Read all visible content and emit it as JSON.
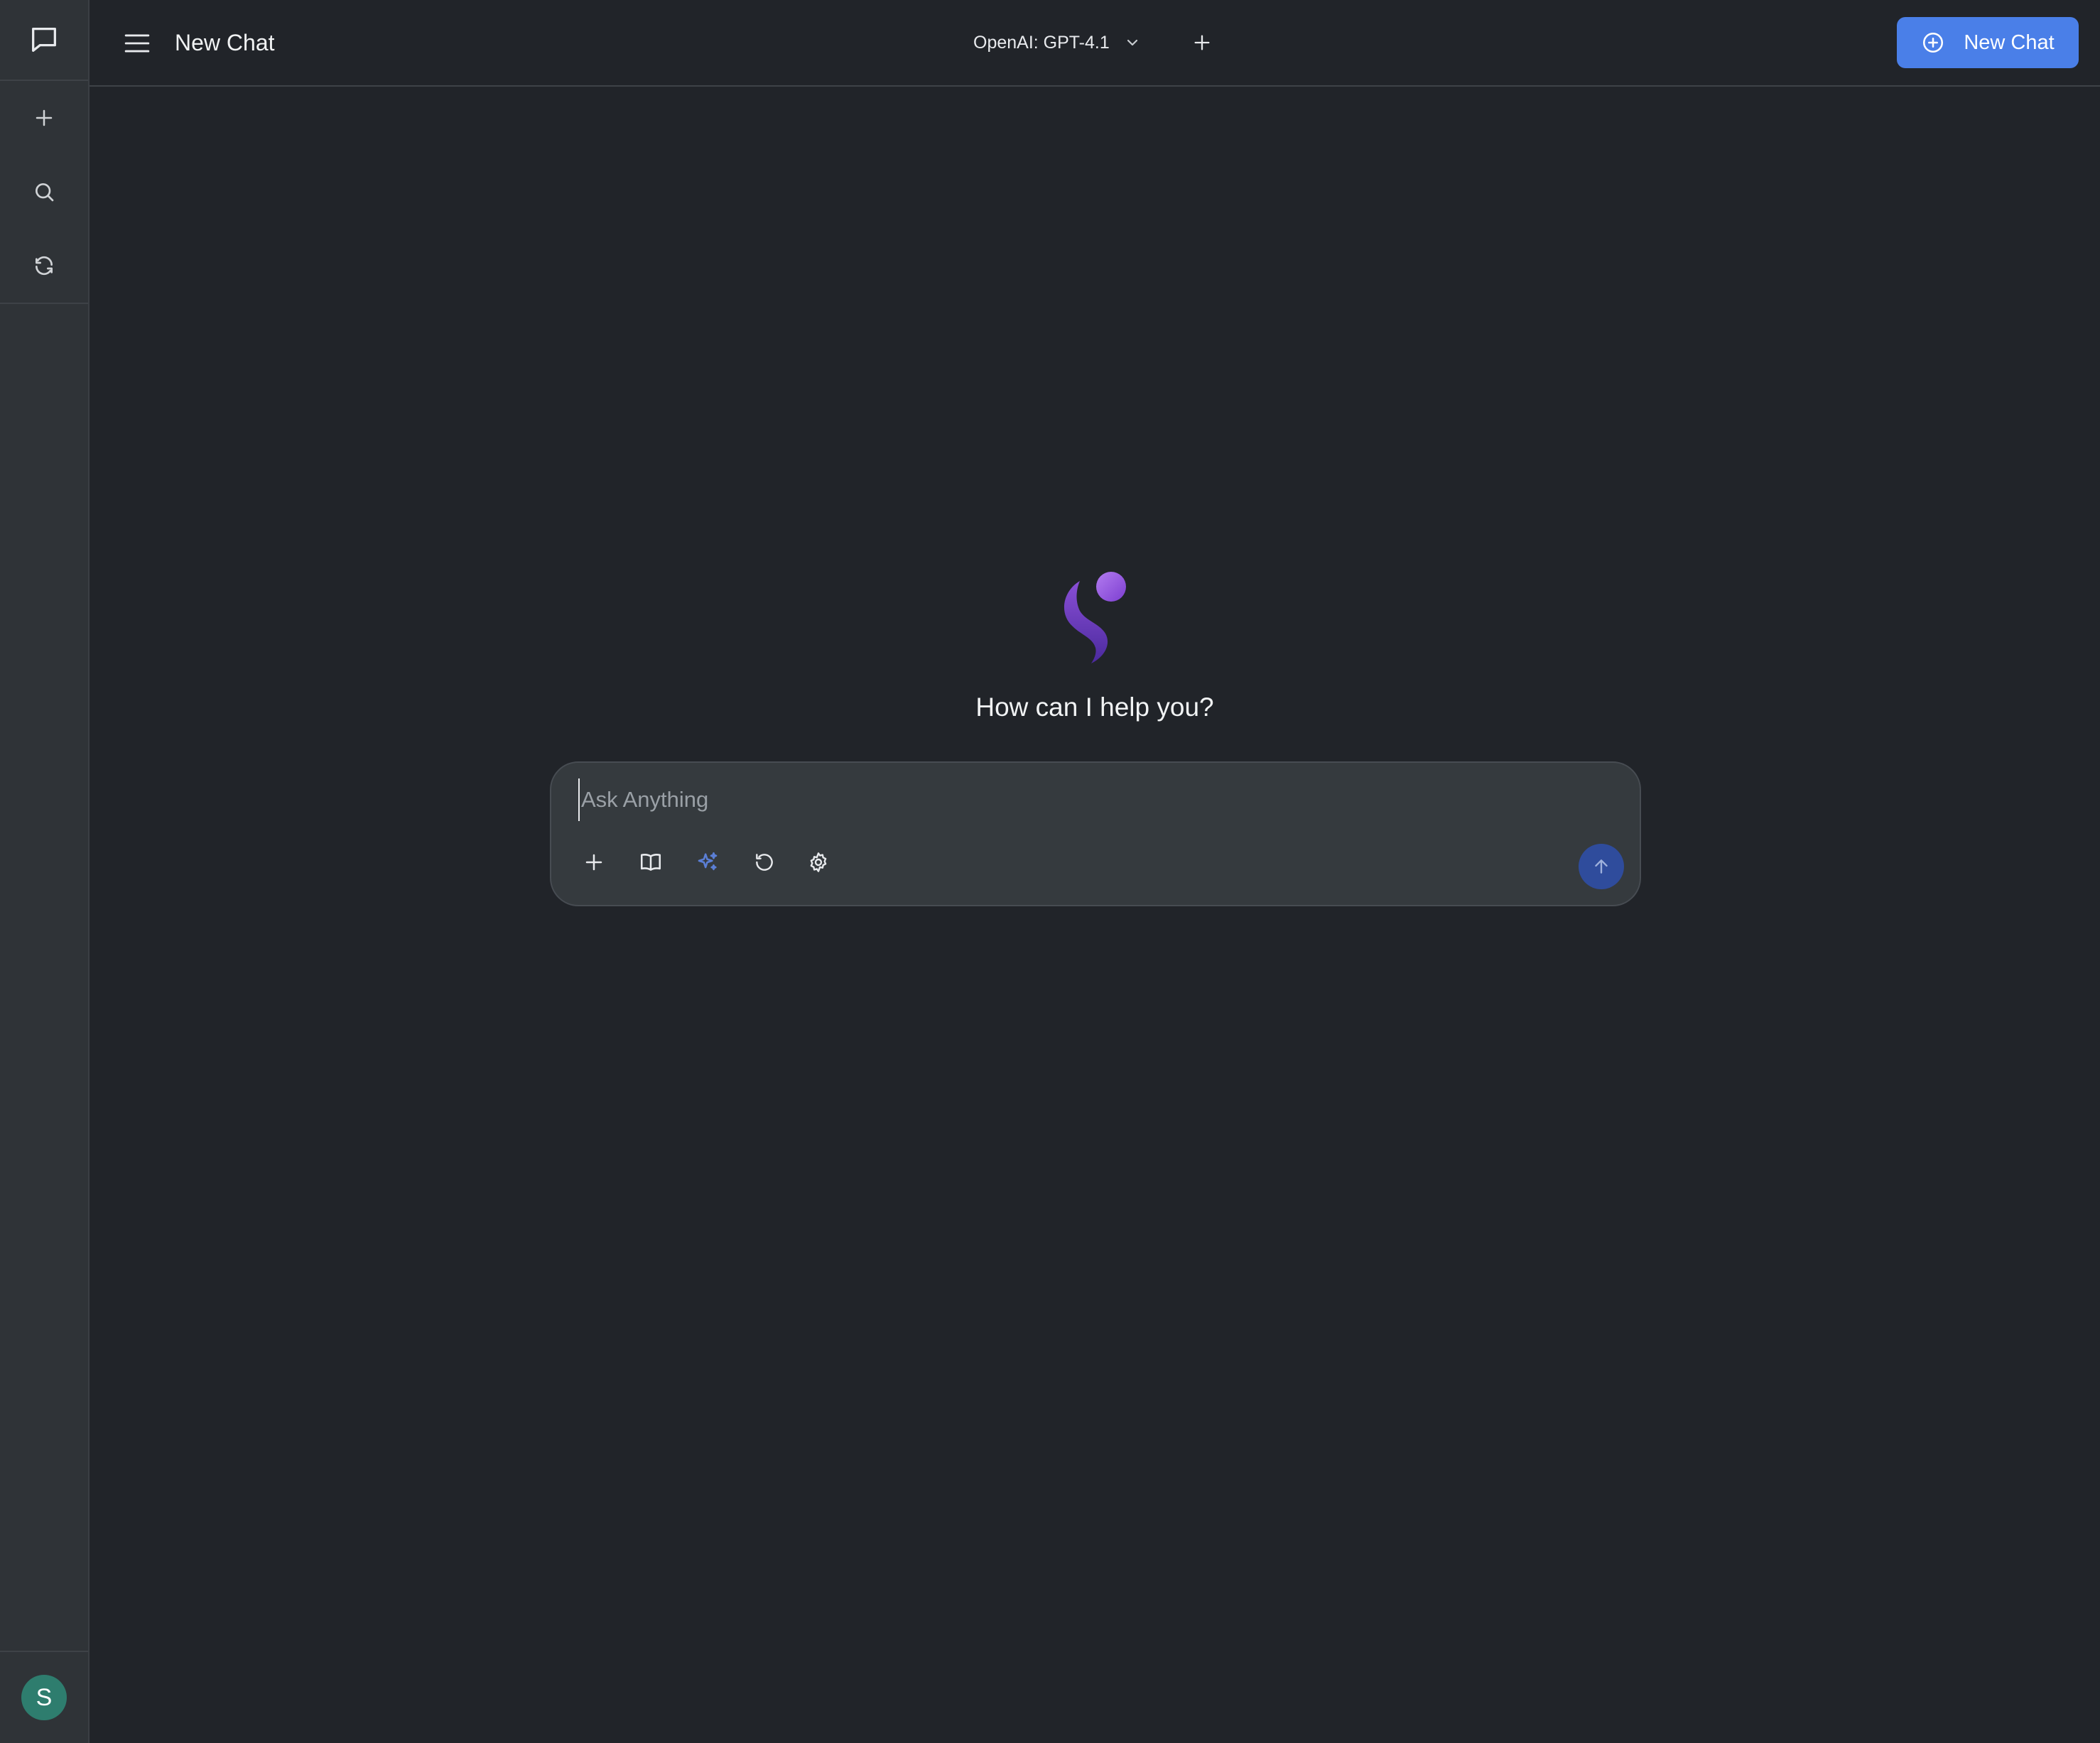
{
  "header": {
    "title": "New Chat",
    "model_label": "OpenAI: GPT-4.1",
    "new_chat_label": "New Chat"
  },
  "sidebar": {
    "top_icon": "chat-bubble-icon",
    "items": [
      {
        "icon": "plus-icon"
      },
      {
        "icon": "search-icon"
      },
      {
        "icon": "refresh-icon"
      }
    ],
    "avatar_initial": "S"
  },
  "main": {
    "greeting": "How can I help you?",
    "logo": "assistant-logo"
  },
  "composer": {
    "placeholder": "Ask Anything",
    "value": "",
    "tools": [
      "plus-icon",
      "book-icon",
      "sparkles-icon",
      "history-icon",
      "gear-icon"
    ],
    "send_icon": "arrow-up-icon"
  },
  "colors": {
    "background": "#212429",
    "rail": "#2f3337",
    "composer": "#353a3e",
    "accent": "#4a7fe8",
    "send": "#2f4c9c",
    "avatar": "#2e7d6e",
    "sparkles": "#5b7fd6"
  }
}
